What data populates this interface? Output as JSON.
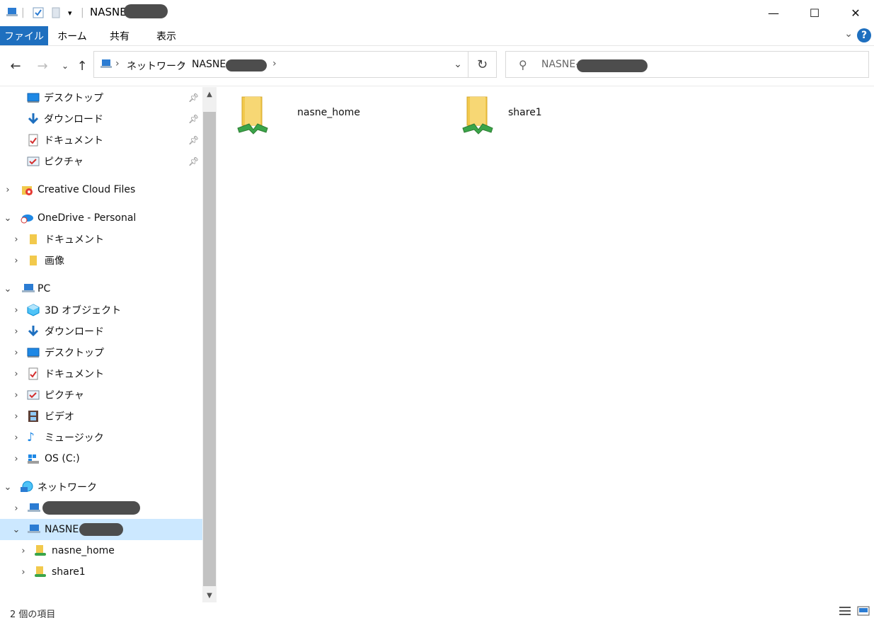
{
  "window": {
    "title": "NASNE-",
    "controls": {
      "minimize": "—",
      "maximize": "☐",
      "close": "✕"
    }
  },
  "ribbon": {
    "tabs": [
      "ファイル",
      "ホーム",
      "共有",
      "表示"
    ],
    "help": "?"
  },
  "address": {
    "crumbs": [
      "ネットワーク",
      "NASNE-"
    ],
    "search_placeholder": "NASNE-"
  },
  "nav_pane": {
    "quick_access": [
      {
        "label": "デスクトップ",
        "icon": "desktop-icon"
      },
      {
        "label": "ダウンロード",
        "icon": "download-icon"
      },
      {
        "label": "ドキュメント",
        "icon": "document-icon"
      },
      {
        "label": "ピクチャ",
        "icon": "pictures-icon"
      }
    ],
    "creative_cloud": "Creative Cloud Files",
    "onedrive": {
      "label": "OneDrive - Personal",
      "children": [
        "ドキュメント",
        "画像"
      ]
    },
    "pc": {
      "label": "PC",
      "children": [
        {
          "label": "3D オブジェクト",
          "icon": "3d-objects-icon"
        },
        {
          "label": "ダウンロード",
          "icon": "download-icon"
        },
        {
          "label": "デスクトップ",
          "icon": "desktop-icon"
        },
        {
          "label": "ドキュメント",
          "icon": "document-icon"
        },
        {
          "label": "ピクチャ",
          "icon": "pictures-icon"
        },
        {
          "label": "ビデオ",
          "icon": "video-icon"
        },
        {
          "label": "ミュージック",
          "icon": "music-icon"
        },
        {
          "label": "OS (C:)",
          "icon": "drive-icon"
        }
      ]
    },
    "network": {
      "label": "ネットワーク",
      "children": [
        {
          "label": ""
        },
        {
          "label": "NASNE-",
          "selected": true,
          "children": [
            "nasne_home",
            "share1"
          ]
        }
      ]
    }
  },
  "content": {
    "items": [
      {
        "name": "nasne_home"
      },
      {
        "name": "share1"
      }
    ]
  },
  "status": {
    "item_count": "2 個の項目"
  },
  "colors": {
    "accent": "#1e6fbf",
    "selection": "#cce8ff",
    "folder": "#f2c94c",
    "share_green": "#3aa54a",
    "redaction": "#4d4d4d"
  }
}
